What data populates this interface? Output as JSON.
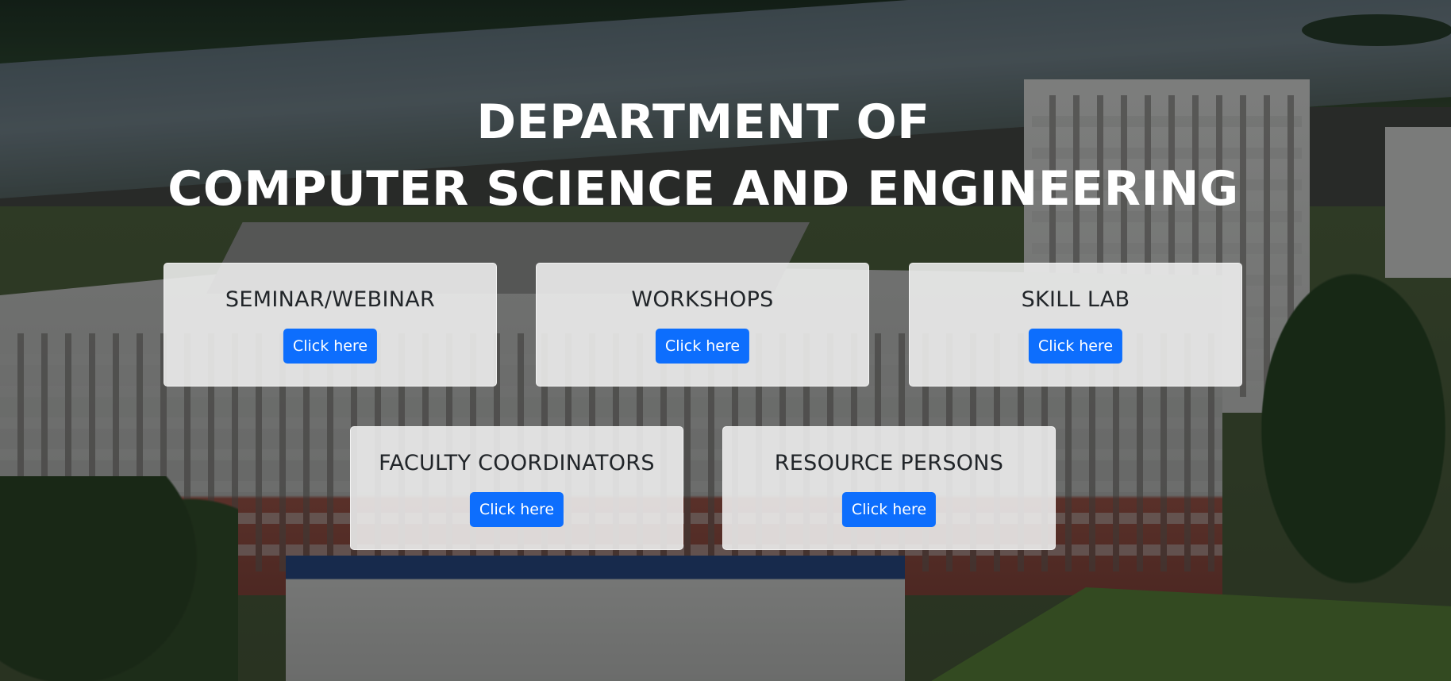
{
  "header": {
    "title_line1": "DEPARTMENT OF",
    "title_line2": "COMPUTER SCIENCE AND ENGINEERING"
  },
  "cards": [
    {
      "title": "SEMINAR/WEBINAR",
      "button_label": "Click here"
    },
    {
      "title": "WORKSHOPS",
      "button_label": "Click here"
    },
    {
      "title": "SKILL LAB",
      "button_label": "Click here"
    },
    {
      "title": "FACULTY COORDINATORS",
      "button_label": "Click here"
    },
    {
      "title": "RESOURCE PERSONS",
      "button_label": "Click here"
    }
  ],
  "colors": {
    "button": "#0d6efd",
    "card_background": "#f0f0f0",
    "title_text": "#ffffff"
  },
  "background": {
    "type": "photo",
    "subject": "campus-buildings"
  }
}
